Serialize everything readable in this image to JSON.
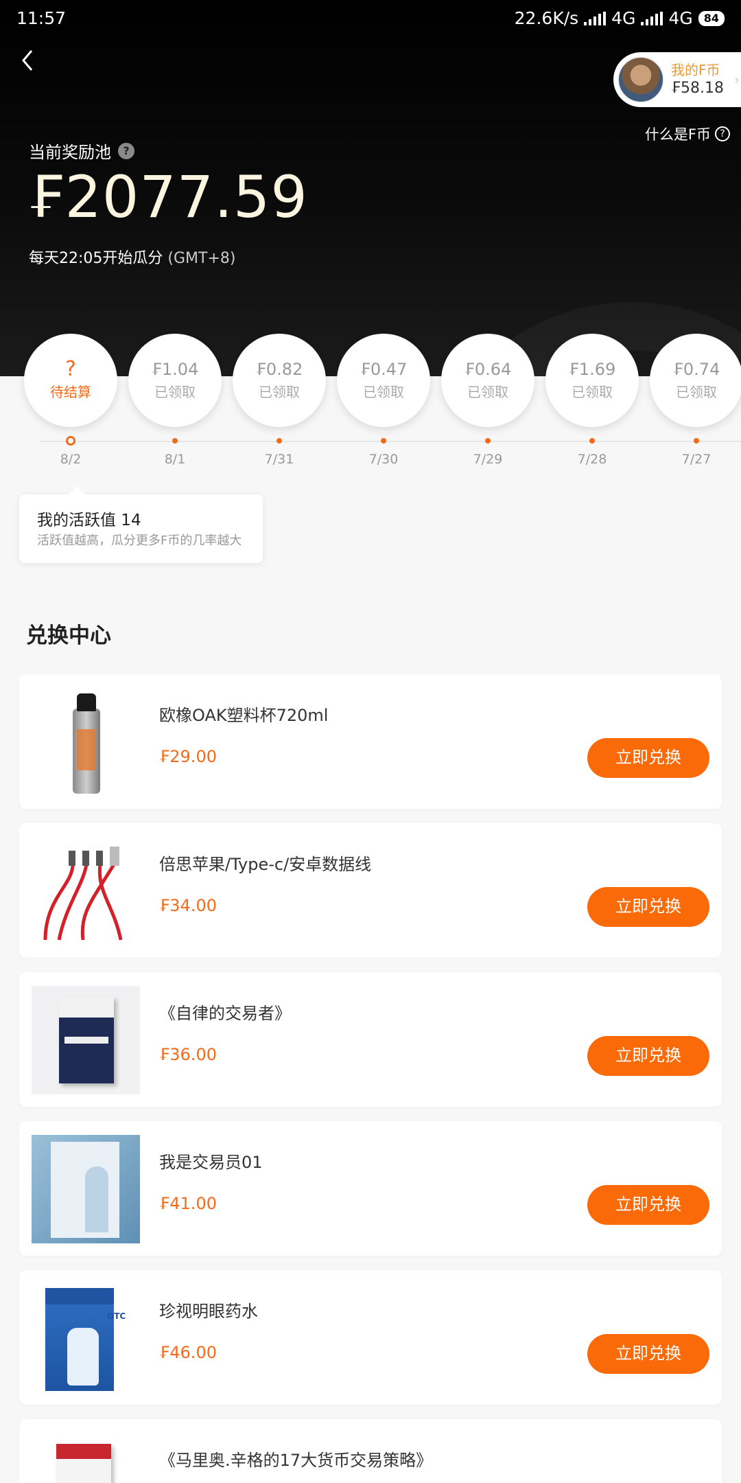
{
  "status_bar": {
    "time": "11:57",
    "speed": "22.6K/s",
    "net1": "4G",
    "net2": "4G",
    "battery": "84"
  },
  "header": {
    "my_coin_label": "我的F币",
    "my_coin_value": "₣58.18",
    "what_is_f": "什么是F币"
  },
  "pool": {
    "label": "当前奖励池",
    "amount": "₣2077.59",
    "note": "每天22:05开始瓜分",
    "timezone": "(GMT+8)"
  },
  "days": [
    {
      "amount": "?",
      "status": "待结算",
      "date": "8/2",
      "current": true
    },
    {
      "amount": "₣1.04",
      "status": "已领取",
      "date": "8/1"
    },
    {
      "amount": "₣0.82",
      "status": "已领取",
      "date": "7/31"
    },
    {
      "amount": "₣0.47",
      "status": "已领取",
      "date": "7/30"
    },
    {
      "amount": "₣0.64",
      "status": "已领取",
      "date": "7/29"
    },
    {
      "amount": "₣1.69",
      "status": "已领取",
      "date": "7/28"
    },
    {
      "amount": "₣0.74",
      "status": "已领取",
      "date": "7/27"
    }
  ],
  "activity": {
    "title": "我的活跃值 14",
    "subtitle": "活跃值越高，瓜分更多F币的几率越大"
  },
  "exchange": {
    "title": "兑换中心",
    "button_label": "立即兑换",
    "items": [
      {
        "name": "欧橡OAK塑料杯720ml",
        "price": "₣29.00"
      },
      {
        "name": "倍思苹果/Type-c/安卓数据线",
        "price": "₣34.00"
      },
      {
        "name": "《自律的交易者》",
        "price": "₣36.00"
      },
      {
        "name": "我是交易员01",
        "price": "₣41.00"
      },
      {
        "name": "珍视明眼药水",
        "price": "₣46.00"
      },
      {
        "name": "《马里奥.辛格的17大货币交易策略》",
        "price": ""
      }
    ]
  },
  "colors": {
    "accent": "#fb6a09",
    "price": "#f46a19",
    "hero_bg": "#000000"
  }
}
